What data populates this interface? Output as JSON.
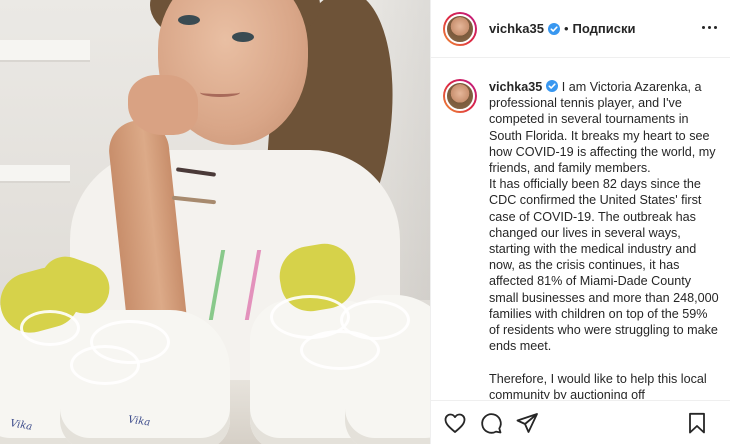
{
  "post": {
    "username": "vichka35",
    "separator": "•",
    "follow_label": "Подписки",
    "caption_user": "vichka35",
    "caption_text": " I am Victoria Azarenka, a professional tennis player, and I've competed in several tournaments in South Florida. It breaks my heart to see how COVID-19 is affecting the world, my friends, and family members.\nIt has officially been 82 days since the CDC confirmed the United States' first case of COVID-19. The outbreak has changed our lives in several ways, starting with the medical industry and now, as the crisis continues, it has affected 81% of Miami-Dade County small businesses and more than 248,000 families with children on top of the 59% of residents who were struggling to make ends meet.\n\nTherefore, I would like to help this local community by auctioning off",
    "photo_signature": "Vika"
  },
  "icons": {
    "more": "more-horizontal-icon",
    "verified": "verified-badge-icon",
    "like": "heart-icon",
    "comment": "comment-icon",
    "share": "paper-plane-icon",
    "save": "bookmark-icon"
  },
  "colors": {
    "verified": "#3897f0",
    "text": "#262626",
    "border": "#efefef"
  }
}
